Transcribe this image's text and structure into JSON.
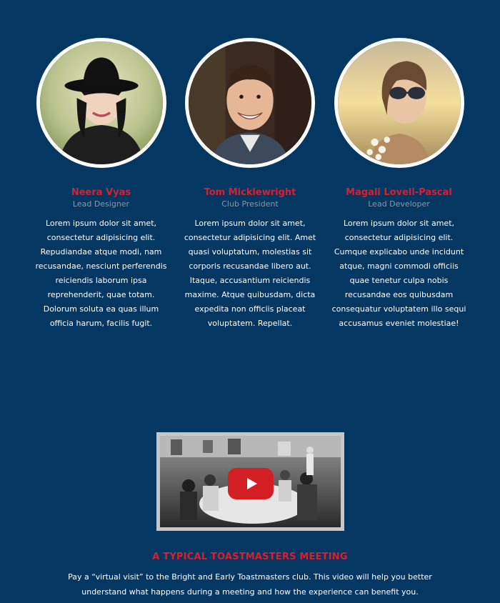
{
  "team": [
    {
      "name": "Neera Vyas",
      "role": "Lead Designer",
      "bio": "Lorem ipsum dolor sit amet, consectetur adipisicing elit. Repudiandae atque modi, nam recusandae, nesciunt perferendis reiciendis laborum ipsa reprehenderit, quae totam. Dolorum soluta ea quas illum officia harum, facilis fugit."
    },
    {
      "name": "Tom Micklewright",
      "role": "Club President",
      "bio": "Lorem ipsum dolor sit amet, consectetur adipisicing elit. Amet quasi voluptatum, molestias sit corporis recusandae libero aut. Itaque, accusantium reiciendis maxime. Atque quibusdam, dicta expedita non officiis placeat voluptatem. Repellat."
    },
    {
      "name": "Magali Lovell-Pascal",
      "role": "Lead Developer",
      "bio": "Lorem ipsum dolor sit amet, consectetur adipisicing elit. Cumque explicabo unde incidunt atque, magni commodi officiis quae tenetur culpa nobis recusandae eos quibusdam consequatur voluptatem illo sequi accusamus eveniet molestiae!"
    }
  ],
  "video": {
    "play_icon": "youtube-play-icon"
  },
  "meeting": {
    "title": "A TYPICAL TOASTMASTERS MEETING",
    "description": "Pay a “virtual visit” to the Bright and Early Toastmasters club. This video will help you better understand what happens during a meeting and how the experience can benefit you."
  },
  "colors": {
    "background": "#053763",
    "accent": "#d8202f",
    "muted": "#8a97a6"
  }
}
